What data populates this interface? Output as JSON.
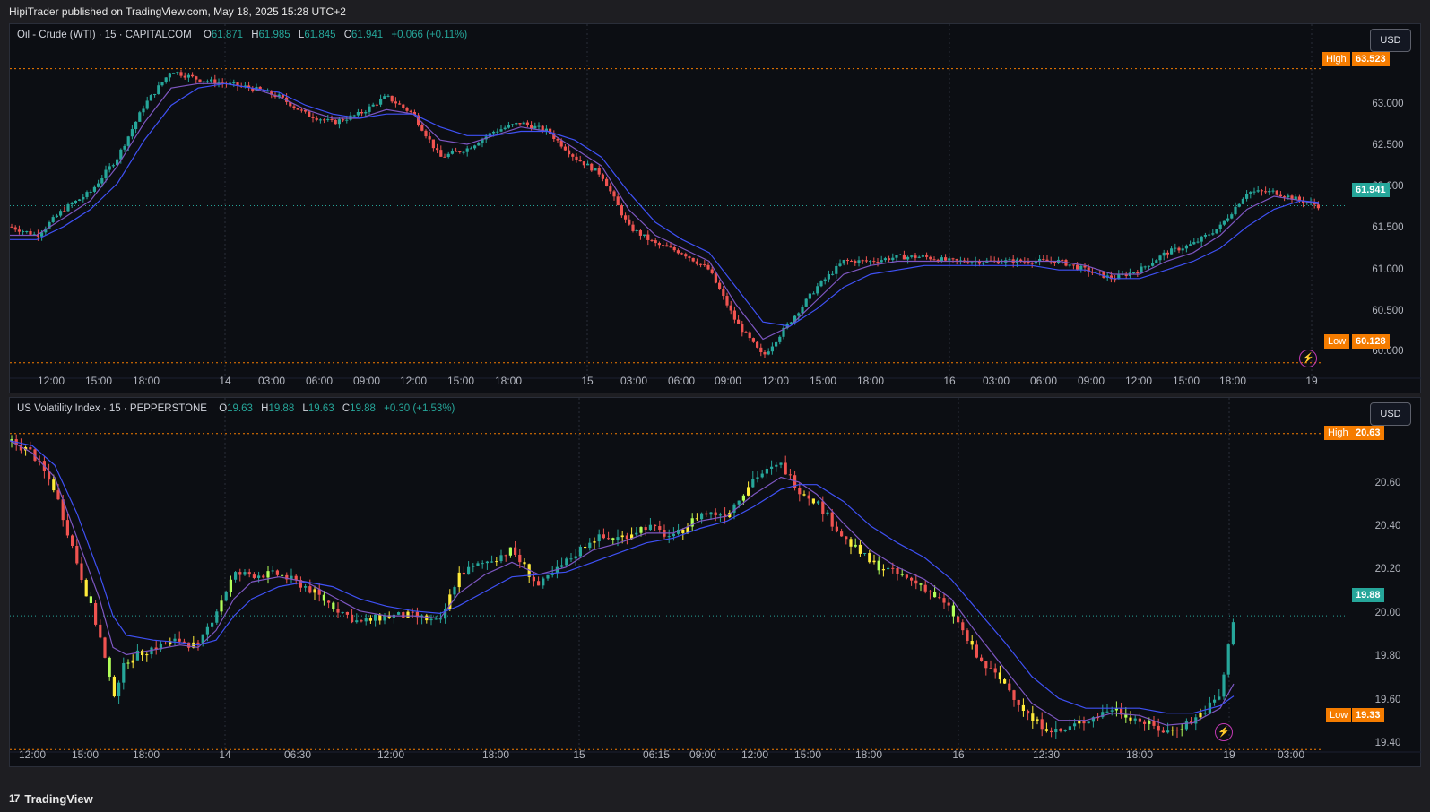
{
  "header": {
    "published": "HipiTrader published on TradingView.com, May 18, 2025 15:28 UTC+2"
  },
  "footer": {
    "brand": "TradingView",
    "logo_mark": "17"
  },
  "panes": [
    {
      "symbol": "Oil - Crude (WTI) · 15 · CAPITALCOM",
      "o_label": "O",
      "o": "61.871",
      "h_label": "H",
      "h": "61.985",
      "l_label": "L",
      "l": "61.845",
      "c_label": "C",
      "c": "61.941",
      "change": "+0.066 (+0.11%)",
      "currency": "USD",
      "last_price": "61.941",
      "high_label": "High",
      "high_value": "63.523",
      "low_label": "Low",
      "low_value": "60.128",
      "y_ticks": [
        "63.000",
        "62.500",
        "62.000",
        "61.500",
        "61.000",
        "60.500",
        "60.000"
      ],
      "x_ticks": [
        "12:00",
        "15:00",
        "18:00",
        "14",
        "03:00",
        "06:00",
        "09:00",
        "12:00",
        "15:00",
        "18:00",
        "15",
        "03:00",
        "06:00",
        "09:00",
        "12:00",
        "15:00",
        "18:00",
        "16",
        "03:00",
        "06:00",
        "09:00",
        "12:00",
        "15:00",
        "18:00",
        "19"
      ]
    },
    {
      "symbol": "US Volatility Index · 15 · PEPPERSTONE",
      "o_label": "O",
      "o": "19.63",
      "h_label": "H",
      "h": "19.88",
      "l_label": "L",
      "l": "19.63",
      "c_label": "C",
      "c": "19.88",
      "change": "+0.30 (+1.53%)",
      "currency": "USD",
      "last_price": "19.88",
      "high_label": "High",
      "high_value": "20.63",
      "low_label": "Low",
      "low_value": "19.33",
      "y_ticks": [
        "20.60",
        "20.40",
        "20.20",
        "20.00",
        "19.80",
        "19.60",
        "19.40"
      ],
      "x_ticks": [
        "12:00",
        "15:00",
        "18:00",
        "14",
        "06:30",
        "12:00",
        "18:00",
        "15",
        "06:15",
        "09:00",
        "12:00",
        "15:00",
        "18:00",
        "16",
        "12:30",
        "18:00",
        "19",
        "03:00"
      ]
    }
  ],
  "colors": {
    "up": "#26a69a",
    "down": "#ef5350",
    "yellow": "#ffeb3b",
    "lime": "#b2ff59",
    "ma_fast": "#7e57c2",
    "ma_slow": "#3f51f5",
    "hl_line": "#f57c00",
    "last_line": "#26a69a"
  },
  "chart_data": [
    {
      "type": "candlestick",
      "title": "Oil - Crude (WTI) · 15 · CAPITALCOM",
      "ylim": [
        59.95,
        63.85
      ],
      "high": 63.523,
      "low": 60.128,
      "last": 61.941,
      "path_x": [
        0,
        30,
        60,
        90,
        120,
        150,
        180,
        210,
        240,
        270,
        300,
        330,
        360,
        390,
        420,
        450,
        480,
        510,
        540,
        570,
        600,
        630,
        660,
        690,
        720,
        750,
        780,
        810,
        840,
        870,
        900,
        930,
        960,
        990,
        1020,
        1050,
        1080,
        1110,
        1140,
        1170,
        1200,
        1230,
        1260,
        1290,
        1320,
        1350,
        1380,
        1410,
        1440,
        1460
      ],
      "path_y": [
        61.7,
        61.6,
        61.9,
        62.1,
        62.5,
        63.1,
        63.5,
        63.4,
        63.35,
        63.3,
        63.2,
        63.0,
        62.9,
        63.0,
        63.2,
        63.0,
        62.5,
        62.6,
        62.8,
        62.9,
        62.8,
        62.5,
        62.3,
        61.7,
        61.5,
        61.4,
        61.2,
        60.6,
        60.2,
        60.6,
        61.0,
        61.3,
        61.3,
        61.35,
        61.35,
        61.3,
        61.3,
        61.3,
        61.3,
        61.3,
        61.2,
        61.1,
        61.2,
        61.4,
        61.5,
        61.7,
        62.1,
        62.1,
        62.0,
        61.94
      ],
      "ma_fast_y": [
        61.6,
        61.6,
        61.8,
        62.0,
        62.4,
        62.9,
        63.3,
        63.35,
        63.35,
        63.3,
        63.2,
        63.05,
        62.95,
        62.95,
        63.05,
        63.0,
        62.7,
        62.65,
        62.75,
        62.85,
        62.8,
        62.6,
        62.4,
        61.9,
        61.6,
        61.45,
        61.3,
        60.8,
        60.4,
        60.55,
        60.85,
        61.15,
        61.25,
        61.3,
        61.3,
        61.3,
        61.3,
        61.3,
        61.3,
        61.3,
        61.25,
        61.15,
        61.15,
        61.3,
        61.4,
        61.6,
        61.9,
        62.05,
        62.0,
        61.96
      ],
      "ma_slow_y": [
        61.55,
        61.55,
        61.7,
        61.9,
        62.2,
        62.7,
        63.1,
        63.3,
        63.35,
        63.3,
        63.25,
        63.1,
        63.0,
        62.95,
        63.0,
        63.0,
        62.85,
        62.75,
        62.75,
        62.8,
        62.8,
        62.7,
        62.5,
        62.1,
        61.75,
        61.55,
        61.4,
        61.0,
        60.6,
        60.55,
        60.75,
        61.0,
        61.15,
        61.2,
        61.25,
        61.25,
        61.25,
        61.25,
        61.25,
        61.2,
        61.2,
        61.1,
        61.1,
        61.2,
        61.3,
        61.45,
        61.7,
        61.9,
        62.0,
        61.98
      ]
    },
    {
      "type": "candlestick",
      "title": "US Volatility Index · 15 · PEPPERSTONE",
      "ylim": [
        19.32,
        20.71
      ],
      "high": 20.63,
      "low": 19.33,
      "last": 19.88,
      "path_x": [
        0,
        25,
        50,
        75,
        100,
        115,
        130,
        160,
        190,
        210,
        230,
        250,
        270,
        300,
        330,
        360,
        390,
        420,
        450,
        480,
        500,
        530,
        560,
        590,
        620,
        650,
        680,
        710,
        740,
        770,
        800,
        830,
        860,
        880,
        900,
        930,
        960,
        990,
        1020,
        1050,
        1080,
        1110,
        1140,
        1170,
        1200,
        1230,
        1260,
        1290,
        1320,
        1350,
        1365
      ],
      "path_y": [
        20.6,
        20.55,
        20.4,
        20.1,
        19.8,
        19.55,
        19.7,
        19.75,
        19.78,
        19.75,
        19.9,
        20.05,
        20.05,
        20.05,
        20.0,
        19.92,
        19.85,
        19.88,
        19.88,
        19.85,
        20.05,
        20.1,
        20.15,
        20.0,
        20.1,
        20.2,
        20.2,
        20.25,
        20.2,
        20.3,
        20.3,
        20.45,
        20.5,
        20.4,
        20.35,
        20.2,
        20.1,
        20.05,
        20.0,
        19.9,
        19.7,
        19.6,
        19.45,
        19.4,
        19.45,
        19.5,
        19.45,
        19.4,
        19.45,
        19.55,
        19.88
      ],
      "ma_fast_y": [
        20.6,
        20.55,
        20.45,
        20.2,
        19.95,
        19.75,
        19.72,
        19.74,
        19.76,
        19.75,
        19.82,
        19.95,
        20.02,
        20.04,
        20.02,
        19.96,
        19.9,
        19.88,
        19.88,
        19.87,
        19.97,
        20.05,
        20.1,
        20.05,
        20.08,
        20.15,
        20.18,
        20.22,
        20.22,
        20.27,
        20.29,
        20.38,
        20.45,
        20.43,
        20.38,
        20.26,
        20.15,
        20.08,
        20.03,
        19.95,
        19.8,
        19.66,
        19.52,
        19.45,
        19.45,
        19.48,
        19.47,
        19.43,
        19.44,
        19.5,
        19.6
      ],
      "ma_slow_y": [
        20.6,
        20.58,
        20.5,
        20.3,
        20.05,
        19.88,
        19.8,
        19.78,
        19.77,
        19.76,
        19.78,
        19.88,
        19.95,
        20.0,
        20.02,
        20.0,
        19.95,
        19.92,
        19.9,
        19.89,
        19.92,
        19.98,
        20.04,
        20.05,
        20.06,
        20.1,
        20.14,
        20.18,
        20.2,
        20.24,
        20.27,
        20.33,
        20.4,
        20.42,
        20.42,
        20.35,
        20.25,
        20.18,
        20.12,
        20.03,
        19.9,
        19.77,
        19.63,
        19.54,
        19.5,
        19.5,
        19.5,
        19.48,
        19.48,
        19.51,
        19.55
      ]
    }
  ]
}
